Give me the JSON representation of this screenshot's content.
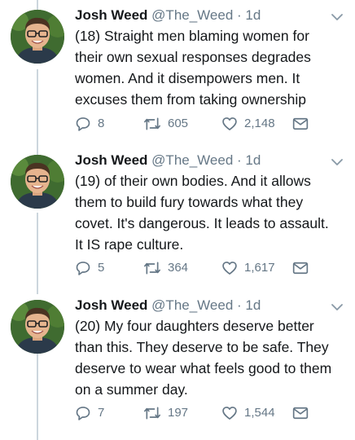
{
  "tweets": [
    {
      "name": "Josh Weed",
      "handle": "@The_Weed",
      "sep": "·",
      "time": "1d",
      "lines": [
        "(18) Straight men blaming women for",
        "their own sexual responses degrades",
        "women. And it disempowers men. It",
        "excuses them from taking ownership"
      ],
      "replies": "8",
      "retweets": "605",
      "likes": "2,148"
    },
    {
      "name": "Josh Weed",
      "handle": "@The_Weed",
      "sep": "·",
      "time": "1d",
      "lines": [
        "(19) of their own bodies. And it allows",
        "them to build fury towards what they",
        "covet. It's dangerous. It leads to assault.",
        "It IS rape culture."
      ],
      "replies": "5",
      "retweets": "364",
      "likes": "1,617"
    },
    {
      "name": "Josh Weed",
      "handle": "@The_Weed",
      "sep": "·",
      "time": "1d",
      "lines": [
        "(20) My four daughters deserve better",
        "than this. They deserve to be safe. They",
        "deserve to wear what feels good to them",
        "on a summer day."
      ],
      "replies": "7",
      "retweets": "197",
      "likes": "1,544"
    }
  ],
  "icons": {
    "reply": "reply-icon",
    "retweet": "retweet-icon",
    "like": "heart-icon",
    "message": "envelope-icon",
    "more": "chevron-down-icon"
  },
  "colors": {
    "text": "#14171a",
    "secondary": "#657786",
    "thread_line": "#ccd6dd",
    "background": "#ffffff"
  }
}
